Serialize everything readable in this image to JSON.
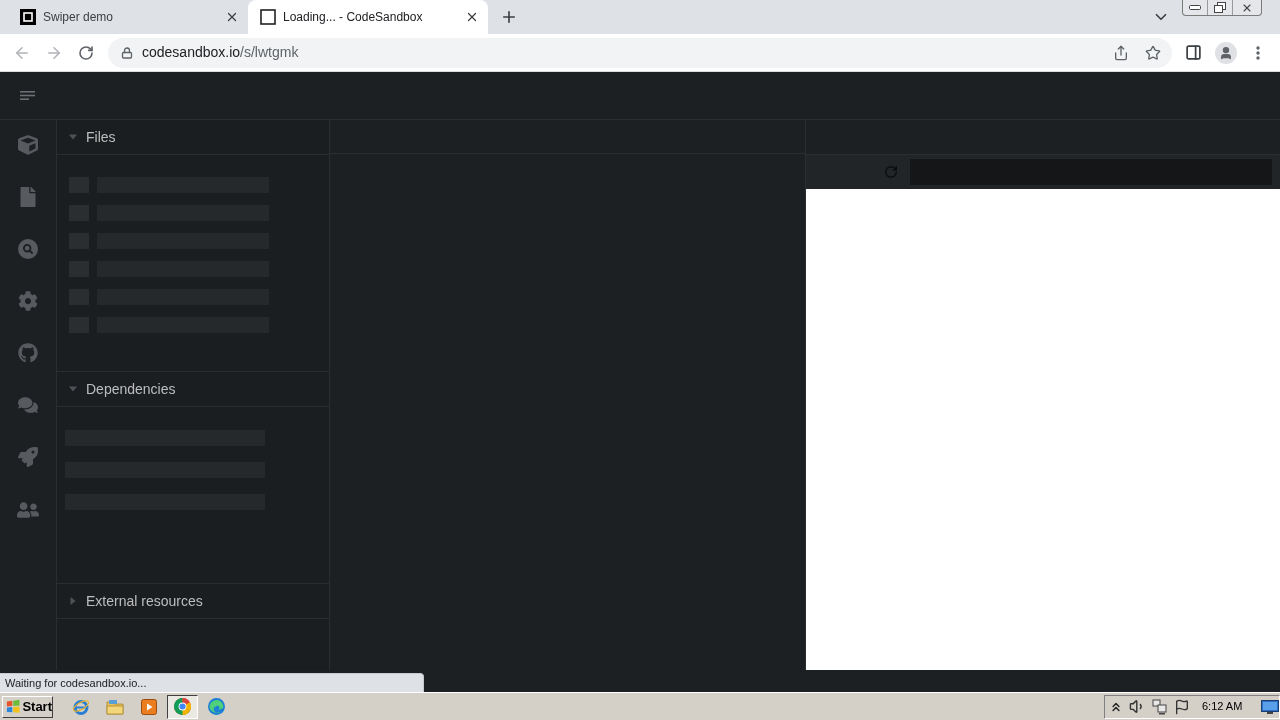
{
  "browser": {
    "tabs": [
      {
        "title": "Swiper demo",
        "selected": false
      },
      {
        "title": "Loading... - CodeSandbox",
        "selected": true
      }
    ],
    "url": {
      "host": "codesandbox.io",
      "path": "/s/lwtgmk"
    }
  },
  "sidebar": {
    "sections": [
      {
        "title": "Files",
        "expanded": true
      },
      {
        "title": "Dependencies",
        "expanded": true
      },
      {
        "title": "External resources",
        "expanded": false
      }
    ]
  },
  "status_bubble": "Waiting for codesandbox.io...",
  "taskbar": {
    "start": "Start",
    "apps": [
      {
        "selected": false
      },
      {
        "selected": false
      },
      {
        "selected": false
      },
      {
        "selected": true
      },
      {
        "selected": false
      }
    ],
    "clock": "6:12 AM"
  }
}
